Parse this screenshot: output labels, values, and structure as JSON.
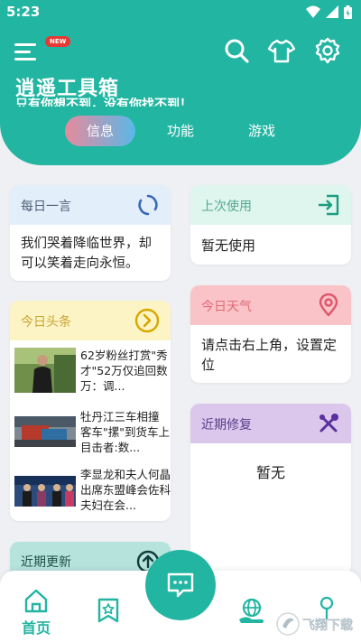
{
  "status": {
    "time": "5:23"
  },
  "header": {
    "new_badge": "NEW",
    "title": "逍遥工具箱",
    "subtitle": "只有你想不到，没有你找不到！",
    "tabs": [
      {
        "label": "信息",
        "active": true
      },
      {
        "label": "功能",
        "active": false
      },
      {
        "label": "游戏",
        "active": false
      }
    ]
  },
  "cards": {
    "daily_quote": {
      "title": "每日一言",
      "text": "我们哭着降临世界，却可以笑着走向永恒。"
    },
    "last_used": {
      "title": "上次使用",
      "text": "暂无使用"
    },
    "headlines": {
      "title": "今日头条",
      "items": [
        {
          "text": "62岁粉丝打赏\"秀才\"52万仅追回数万：调..."
        },
        {
          "text": "牡丹江三车相撞 客车\"摞\"到货车上 目击者:数..."
        },
        {
          "text": "李显龙和夫人何晶出席东盟峰会佐科夫妇在会..."
        }
      ]
    },
    "weather": {
      "title": "今日天气",
      "text": "请点击右上角，设置定位"
    },
    "recent_fix": {
      "title": "近期修复",
      "text": "暂无"
    },
    "recent_update": {
      "title": "近期更新"
    }
  },
  "bottom_nav": {
    "home_label": "首页"
  },
  "colors": {
    "primary": "#22b5a2",
    "quote_head": "#e3eefb",
    "last_used_head": "#dff6ef",
    "headlines_head": "#fdf4c6",
    "weather_head": "#f9c3c7",
    "fix_head": "#dbc7ec",
    "update_head": "#b6e3dc"
  },
  "watermark": "飞翔下载"
}
